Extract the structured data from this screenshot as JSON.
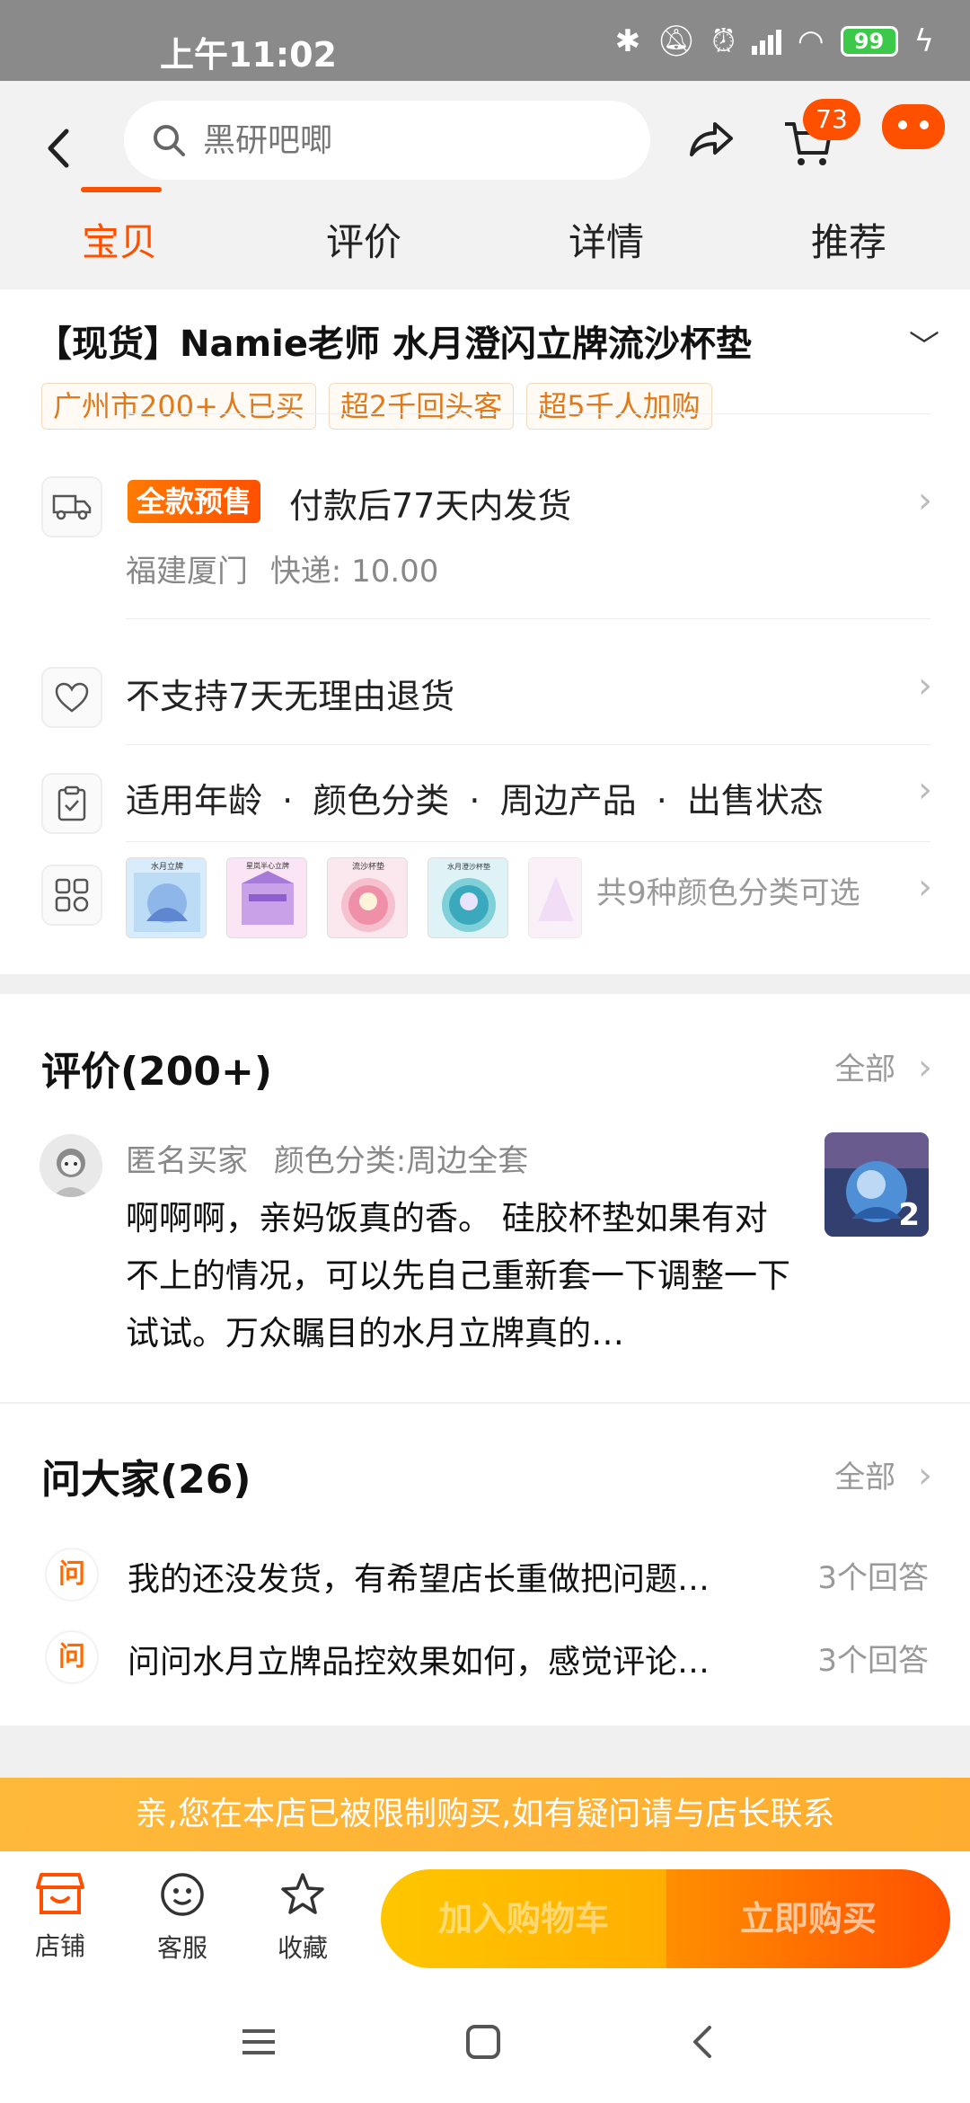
{
  "status_bar": {
    "time": "上午11:02",
    "battery": "99"
  },
  "header": {
    "search_placeholder": "黑研吧唧",
    "cart_badge": "73",
    "tabs": [
      "宝贝",
      "评价",
      "详情",
      "推荐"
    ]
  },
  "product": {
    "title": "【现货】Namie老师 水月澄闪立牌流沙杯垫",
    "tags": [
      "广州市200+人已买",
      "超2千回头客",
      "超5千人加购"
    ],
    "shipping": {
      "presale_badge": "全款预售",
      "text": "付款后77天内发货",
      "origin": "福建厦门",
      "express": "快递: 10.00"
    },
    "return_policy": "不支持7天无理由退货",
    "attributes": [
      "适用年龄",
      "颜色分类",
      "周边产品",
      "出售状态"
    ],
    "attr_separator": "·",
    "variants_text": "共9种颜色分类可选",
    "thumb_labels": [
      "水月立牌",
      "星岚半心立牌",
      "流沙杯垫",
      "水月澄沙杯垫",
      ""
    ]
  },
  "reviews": {
    "title": "评价(200+)",
    "all_label": "全部",
    "user": "匿名买家",
    "variant": "颜色分类:周边全套",
    "body": "啊啊啊，亲妈饭真的香。 硅胶杯垫如果有对不上的情况，可以先自己重新套一下调整一下试试。万众瞩目的水月立牌真的…",
    "photo_count": "2"
  },
  "qa": {
    "title": "问大家(26)",
    "all_label": "全部",
    "badge": "问",
    "items": [
      {
        "question": "我的还没发货，有希望店长重做把问题…",
        "answers": "3个回答"
      },
      {
        "question": "问问水月立牌品控效果如何，感觉评论…",
        "answers": "3个回答"
      }
    ]
  },
  "limit_banner": "亲,您在本店已被限制购买,如有疑问请与店长联系",
  "bottom_bar": {
    "shop": "店铺",
    "service": "客服",
    "favorite": "收藏",
    "add_to_cart": "加入购物车",
    "buy_now": "立即购买"
  },
  "colors": {
    "brand_orange": "#ff5000",
    "tag_text": "#e07a1b",
    "banner": "#ffb93a"
  }
}
